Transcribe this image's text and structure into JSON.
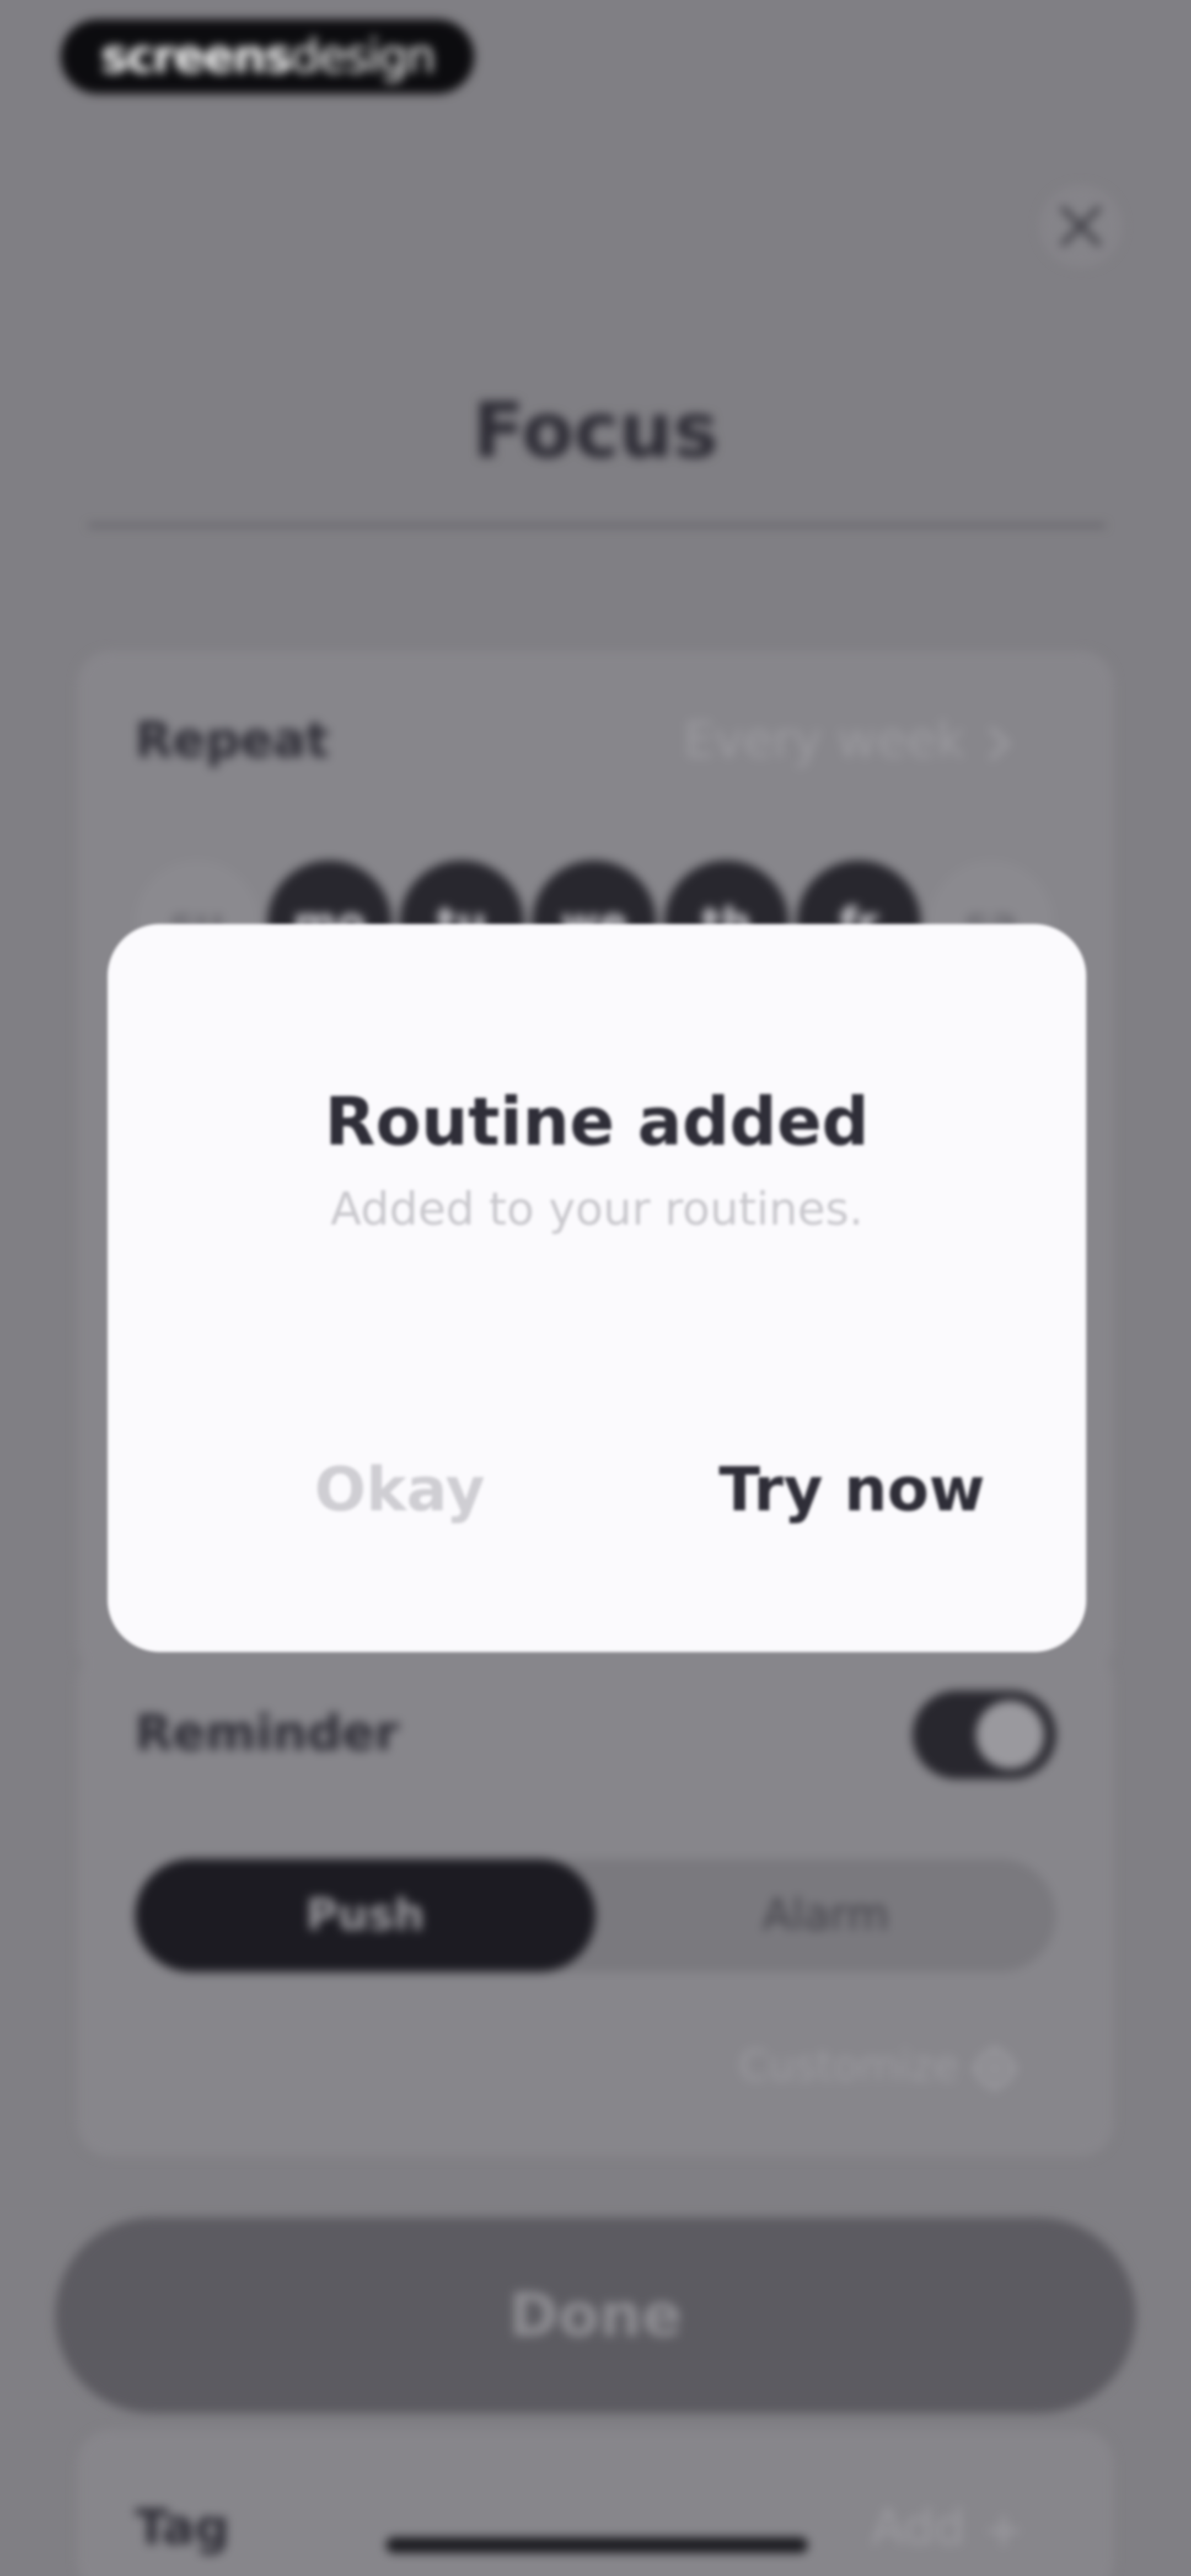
{
  "brand": {
    "part_strong": "screens",
    "part_light": "design"
  },
  "header": {
    "title": "Focus",
    "close_icon": "close-icon"
  },
  "repeat": {
    "label": "Repeat",
    "value": "Every week",
    "chevron_icon": "chevron-right-icon",
    "days": [
      {
        "label": "su",
        "selected": false
      },
      {
        "label": "mo",
        "selected": true
      },
      {
        "label": "tu",
        "selected": true
      },
      {
        "label": "we",
        "selected": true
      },
      {
        "label": "th",
        "selected": true
      },
      {
        "label": "fr",
        "selected": true
      },
      {
        "label": "sa",
        "selected": false
      }
    ]
  },
  "reminder": {
    "label": "Reminder",
    "enabled": true,
    "options": [
      "Push",
      "Alarm"
    ],
    "selected": "Push",
    "customize_label": "Customize",
    "customize_icon": "gear-icon"
  },
  "done_label": "Done",
  "tag": {
    "label": "Tag",
    "add_label": "Add",
    "add_icon": "plus-icon"
  },
  "dialog": {
    "title": "Routine added",
    "message": "Added to your routines.",
    "secondary_label": "Okay",
    "primary_label": "Try now"
  },
  "colors": {
    "overlay": "#807f84",
    "dark": "#28272e",
    "dialog_bg": "#fbfafd",
    "dialog_text": "#2f2e38",
    "muted": "#c9c8cd"
  }
}
